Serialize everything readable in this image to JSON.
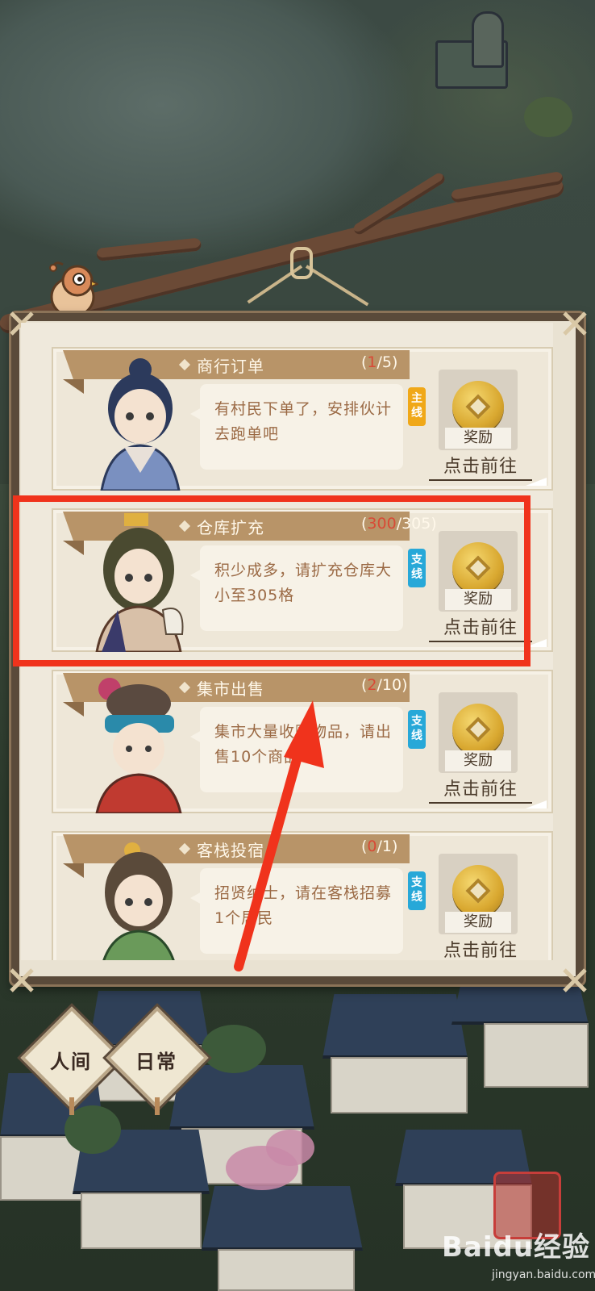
{
  "tasks": [
    {
      "title": "商行订单",
      "progress_current": "1",
      "progress_total": "/5",
      "description": "有村民下单了，安排伙计去跑单吧",
      "tag": "主线",
      "tag_color": "#f0a818",
      "reward_label": "奖励",
      "go_label": "点击前往"
    },
    {
      "title": "仓库扩充",
      "progress_current": "300",
      "progress_total": "/305",
      "description": "积少成多，请扩充仓库大小至305格",
      "tag": "支线",
      "tag_color": "#27a8d8",
      "reward_label": "奖励",
      "go_label": "点击前往"
    },
    {
      "title": "集市出售",
      "progress_current": "2",
      "progress_total": "/10",
      "description": "集市大量收购物品，请出售10个商品",
      "tag": "支线",
      "tag_color": "#27a8d8",
      "reward_label": "奖励",
      "go_label": "点击前往"
    },
    {
      "title": "客栈投宿",
      "progress_current": "0",
      "progress_total": "/1",
      "description": "招贤纳士，请在客栈招募1个居民",
      "tag": "支线",
      "tag_color": "#27a8d8",
      "reward_label": "奖励",
      "go_label": "点击前往"
    }
  ],
  "bottom_tabs": [
    "人间",
    "日常"
  ],
  "watermark": {
    "brand": "Baidu经验",
    "url": "jingyan.baidu.com"
  },
  "colors": {
    "highlight": "#f0331c",
    "progress_current": "#d84a36",
    "banner": "#b89468"
  }
}
